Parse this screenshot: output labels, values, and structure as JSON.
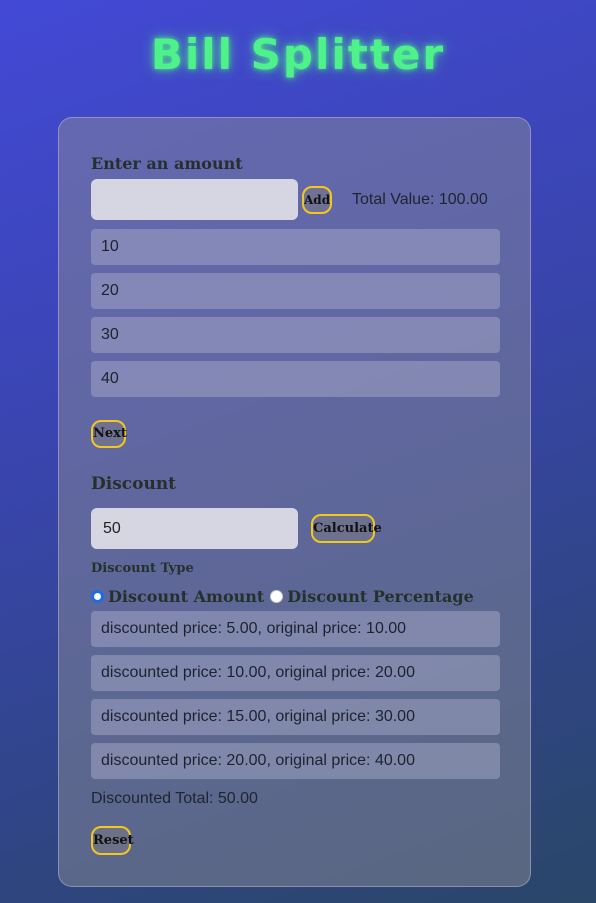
{
  "app_title": "Bill Splitter",
  "amount_section": {
    "label": "Enter an amount",
    "input_value": "",
    "add_label": "Add",
    "total_text": "Total Value: 100.00",
    "items": [
      "10",
      "20",
      "30",
      "40"
    ],
    "next_label": "Next"
  },
  "discount_section": {
    "label": "Discount",
    "input_value": "50",
    "calculate_label": "Calculate",
    "type_label": "Discount Type",
    "options": [
      {
        "label": "Discount Amount",
        "checked": true
      },
      {
        "label": "Discount Percentage",
        "checked": false
      }
    ],
    "results": [
      "discounted price: 5.00, original price: 10.00",
      "discounted price: 10.00, original price: 20.00",
      "discounted price: 15.00, original price: 30.00",
      "discounted price: 20.00, original price: 40.00"
    ],
    "total_text": "Discounted Total: 50.00",
    "reset_label": "Reset"
  },
  "colors": {
    "title": "#4ef28a",
    "button_border": "#f2c81e",
    "radio_selected": "#1b6ee0"
  }
}
